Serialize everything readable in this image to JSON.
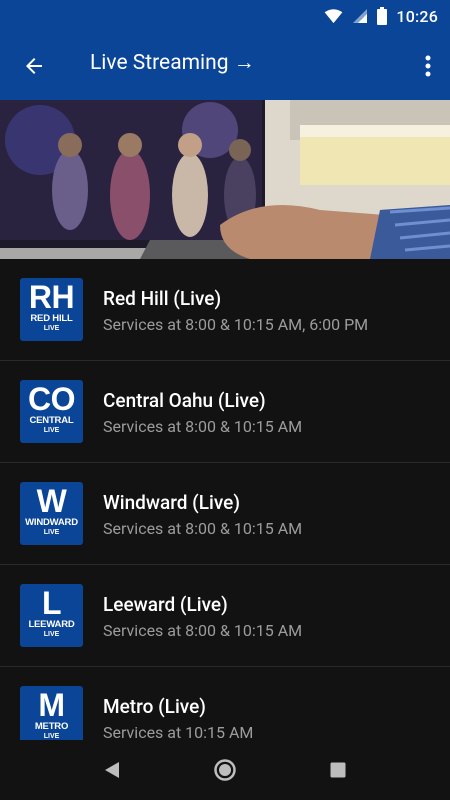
{
  "status_bar": {
    "time": "10:26"
  },
  "app_bar": {
    "title": "Live Streaming →"
  },
  "locations": [
    {
      "abbr": "RH",
      "logo_name": "RED HILL",
      "logo_tag": "LIVE",
      "name": "Red Hill (Live)",
      "schedule": "Services at 8:00 & 10:15 AM, 6:00 PM"
    },
    {
      "abbr": "CO",
      "logo_name": "CENTRAL",
      "logo_tag": "LIVE",
      "name": "Central Oahu (Live)",
      "schedule": "Services at 8:00 & 10:15 AM"
    },
    {
      "abbr": "W",
      "logo_name": "WINDWARD",
      "logo_tag": "LIVE",
      "name": "Windward (Live)",
      "schedule": "Services at 8:00 & 10:15 AM"
    },
    {
      "abbr": "L",
      "logo_name": "LEEWARD",
      "logo_tag": "LIVE",
      "name": "Leeward (Live)",
      "schedule": "Services at 8:00 & 10:15 AM"
    },
    {
      "abbr": "M",
      "logo_name": "METRO",
      "logo_tag": "LIVE",
      "name": "Metro (Live)",
      "schedule": "Services at 10:15 AM"
    }
  ],
  "icons": {
    "status": [
      "wifi-icon",
      "cell-signal-icon",
      "battery-icon"
    ],
    "app_bar": [
      "back-arrow-icon",
      "more-vert-icon"
    ],
    "nav": [
      "nav-back-icon",
      "nav-home-icon",
      "nav-recents-icon"
    ]
  },
  "colors": {
    "brand_blue": "#0b4597",
    "background": "#121212",
    "text_primary": "#ffffff",
    "text_secondary": "#9c9c9c"
  }
}
